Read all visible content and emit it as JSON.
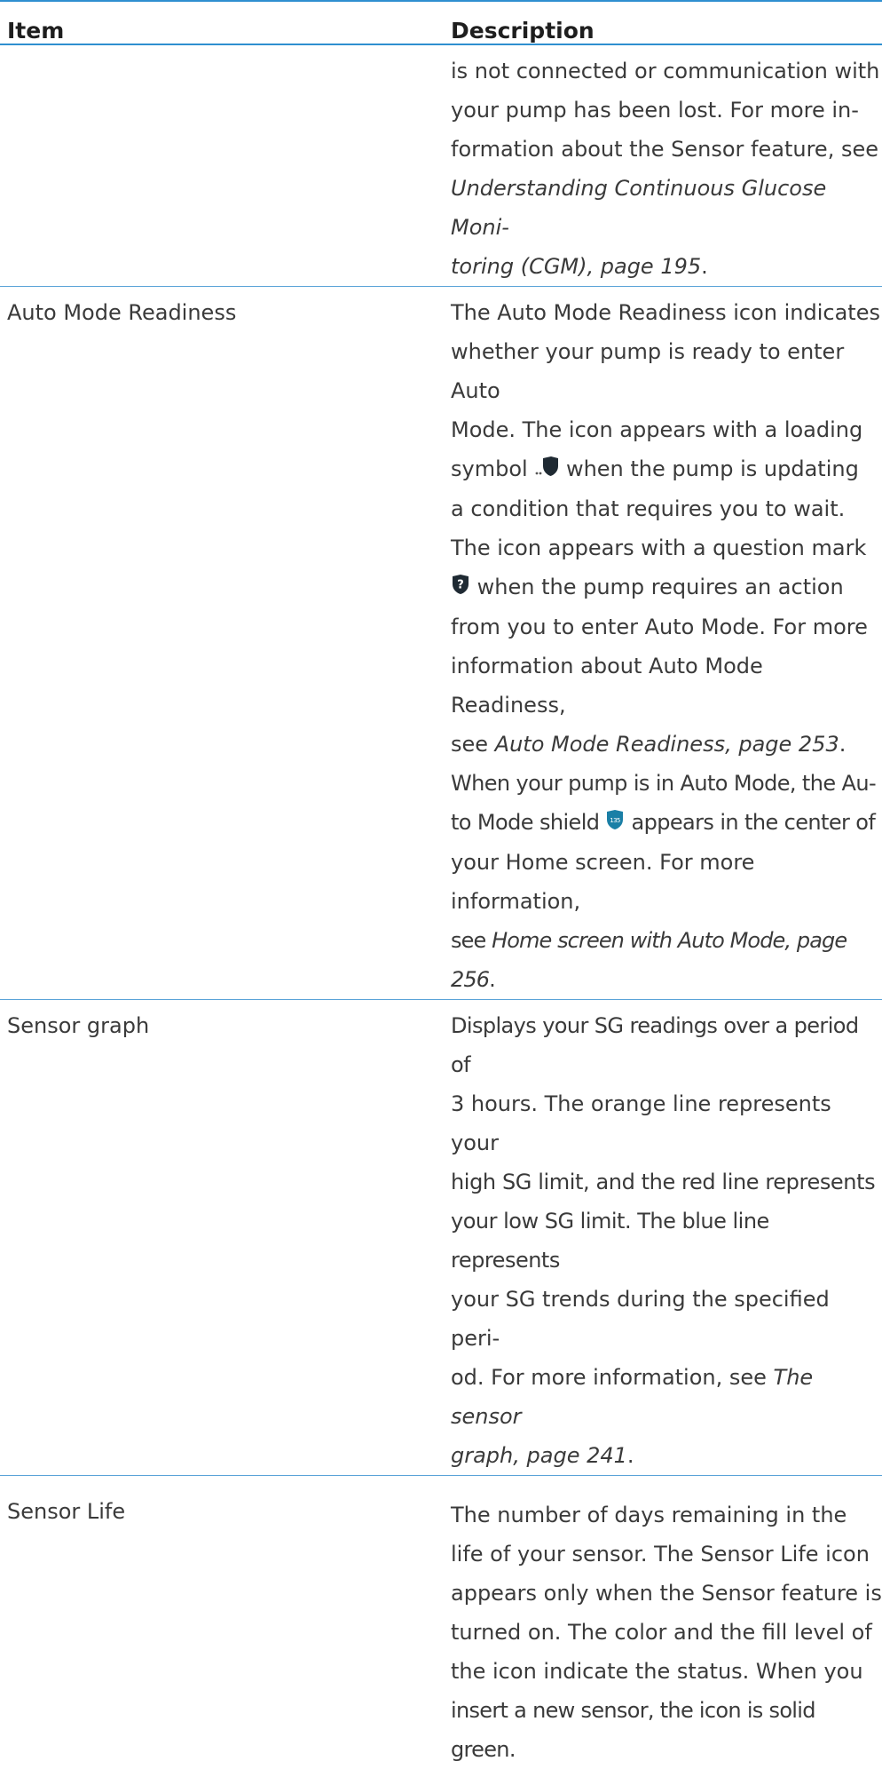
{
  "headers": {
    "item": "Item",
    "description": "Description"
  },
  "row_continued": {
    "line1": "is not connected or communication with",
    "line2": "your pump has been lost. For more in-",
    "line3": "formation about the Sensor feature, see",
    "ref_line1": "Understanding Continuous Glucose Moni-",
    "ref_line2": "toring (CGM), page 195",
    "period": "."
  },
  "row_auto_mode": {
    "item": "Auto Mode Readiness",
    "line1": "The Auto Mode Readiness icon indicates",
    "line2": "whether your pump is ready to enter Auto",
    "line3": "Mode. The icon appears with a loading",
    "line4a": "symbol",
    "line4b": "when the pump is updating",
    "line5": "a condition that requires you to wait.",
    "line6": "The icon appears with a question mark",
    "line7": "when the pump requires an action",
    "line8": "from you to enter Auto Mode. For more",
    "line9": "information about Auto Mode Readiness,",
    "line10a": "see ",
    "line10_ref": "Auto Mode Readiness, page 253",
    "line10b": ".",
    "line11": "When your pump is in Auto Mode, the Au-",
    "line12a": "to Mode shield",
    "shield_value": "135",
    "line12b": "appears in the center of",
    "line13": "your Home screen. For more information,",
    "line14a": "see ",
    "line14_ref": "Home screen with Auto Mode, page 256",
    "line14b": "."
  },
  "row_sensor_graph": {
    "item": "Sensor graph",
    "line1": "Displays your SG readings over a period of",
    "line2": "3 hours. The orange line represents your",
    "line3": "high SG limit, and the red line represents",
    "line4": "your low SG limit. The blue line represents",
    "line5": "your SG trends during the specified peri-",
    "line6a": "od. For more information, see ",
    "line6_ref": "The sensor",
    "line7_ref": "graph, page 241",
    "line7b": "."
  },
  "row_sensor_life": {
    "item": "Sensor Life",
    "line1": "The number of days remaining in the",
    "line2": "life of your sensor. The Sensor Life icon",
    "line3": "appears only when the Sensor feature is",
    "line4": "turned on. The color and the fill level of",
    "line5": "the icon indicate the status. When you",
    "line6": "insert a new sensor, the icon is solid green."
  },
  "colors": {
    "rule": "#2f8fd0",
    "shield": "#1f2a33",
    "shield_auto": "#1a7fa6"
  }
}
